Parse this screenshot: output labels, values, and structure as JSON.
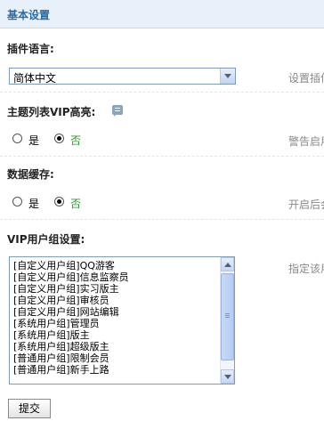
{
  "section": {
    "title": "基本设置"
  },
  "plugin_language": {
    "label": "插件语言:",
    "selected": "简体中文",
    "hint": "设置插件"
  },
  "vip_highlight": {
    "label": "主题列表VIP高亮:",
    "options": [
      "是",
      "否"
    ],
    "selected": "否",
    "hint": "警告启用"
  },
  "data_cache": {
    "label": "数据缓存:",
    "options": [
      "是",
      "否"
    ],
    "selected": "否",
    "hint": "开启后会"
  },
  "vip_groups": {
    "label": "VIP用户组设置:",
    "hint": "指定该用",
    "items": [
      "[自定义用户组]QQ游客",
      "[自定义用户组]信息监察员",
      "[自定义用户组]实习版主",
      "[自定义用户组]审核员",
      "[自定义用户组]网站编辑",
      "[系统用户组]管理员",
      "[系统用户组]版主",
      "[系统用户组]超级版主",
      "[普通用户组]限制会员",
      "[普通用户组]新手上路"
    ]
  },
  "submit": {
    "label": "提交"
  },
  "colors": {
    "accent": "#2c6aa0",
    "header_bg": "#e8f1fa",
    "selected_green": "#2b9c2b",
    "hint": "#888888"
  }
}
